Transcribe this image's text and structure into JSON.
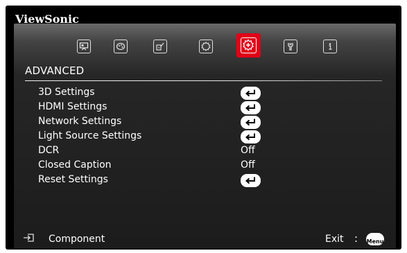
{
  "header": {
    "brand": "ViewSonic"
  },
  "tabs": [
    {
      "name": "display",
      "icon": "display-icon",
      "selected": false
    },
    {
      "name": "image",
      "icon": "palette-icon",
      "selected": false
    },
    {
      "name": "power",
      "icon": "power-management-icon",
      "selected": false
    },
    {
      "name": "basic",
      "icon": "gear-icon",
      "selected": false
    },
    {
      "name": "advanced",
      "icon": "advanced-gear-icon",
      "selected": true
    },
    {
      "name": "system",
      "icon": "wrench-icon",
      "selected": false
    },
    {
      "name": "information",
      "icon": "info-icon",
      "selected": false
    }
  ],
  "page": {
    "title": "ADVANCED"
  },
  "menu": {
    "items": [
      {
        "label": "3D Settings",
        "value": null,
        "type": "submenu"
      },
      {
        "label": "HDMI Settings",
        "value": null,
        "type": "submenu"
      },
      {
        "label": "Network Settings",
        "value": null,
        "type": "submenu"
      },
      {
        "label": "Light Source Settings",
        "value": null,
        "type": "submenu"
      },
      {
        "label": "DCR",
        "value": "Off",
        "type": "value"
      },
      {
        "label": "Closed Caption",
        "value": "Off",
        "type": "value"
      },
      {
        "label": "Reset Settings",
        "value": null,
        "type": "submenu"
      }
    ]
  },
  "footer": {
    "source_icon": "input-source-icon",
    "source": "Component",
    "exit_label": "Exit",
    "separator": ":",
    "menu_key": "Menu"
  },
  "colors": {
    "accent": "#e00018",
    "background": "#000000",
    "text": "#ffffff"
  }
}
